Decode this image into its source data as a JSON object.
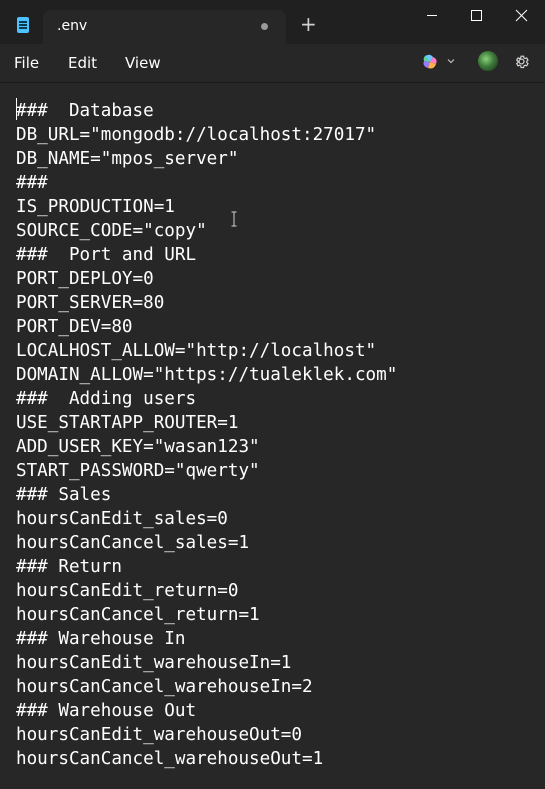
{
  "tab": {
    "title": ".env",
    "modified_indicator": "unsaved-dot",
    "new_tab_label": "+"
  },
  "window_controls": {
    "minimize": "minimize-icon",
    "maximize": "maximize-icon",
    "close": "close-icon"
  },
  "menu": {
    "file": "File",
    "edit": "Edit",
    "view": "View"
  },
  "toolbar": {
    "copilot": "copilot-icon",
    "dropdown": "chevron-down-icon",
    "account": "avatar",
    "settings": "gear-icon"
  },
  "editor": {
    "lines": [
      "###  Database",
      "DB_URL=\"mongodb://localhost:27017\"",
      "DB_NAME=\"mpos_server\"",
      "###",
      "IS_PRODUCTION=1",
      "SOURCE_CODE=\"copy\"",
      "###  Port and URL",
      "PORT_DEPLOY=0",
      "PORT_SERVER=80",
      "PORT_DEV=80",
      "LOCALHOST_ALLOW=\"http://localhost\"",
      "DOMAIN_ALLOW=\"https://tualeklek.com\"",
      "###  Adding users",
      "USE_STARTAPP_ROUTER=1",
      "ADD_USER_KEY=\"wasan123\"",
      "START_PASSWORD=\"qwerty\"",
      "### Sales",
      "hoursCanEdit_sales=0",
      "hoursCanCancel_sales=1",
      "### Return",
      "hoursCanEdit_return=0",
      "hoursCanCancel_return=1",
      "### Warehouse In",
      "hoursCanEdit_warehouseIn=1",
      "hoursCanCancel_warehouseIn=2",
      "### Warehouse Out",
      "hoursCanEdit_warehouseOut=0",
      "hoursCanCancel_warehouseOut=1"
    ]
  },
  "colors": {
    "titlebar_bg": "#202020",
    "editor_bg": "#272727",
    "text": "#ffffff",
    "accent": "#4cc2ff"
  }
}
